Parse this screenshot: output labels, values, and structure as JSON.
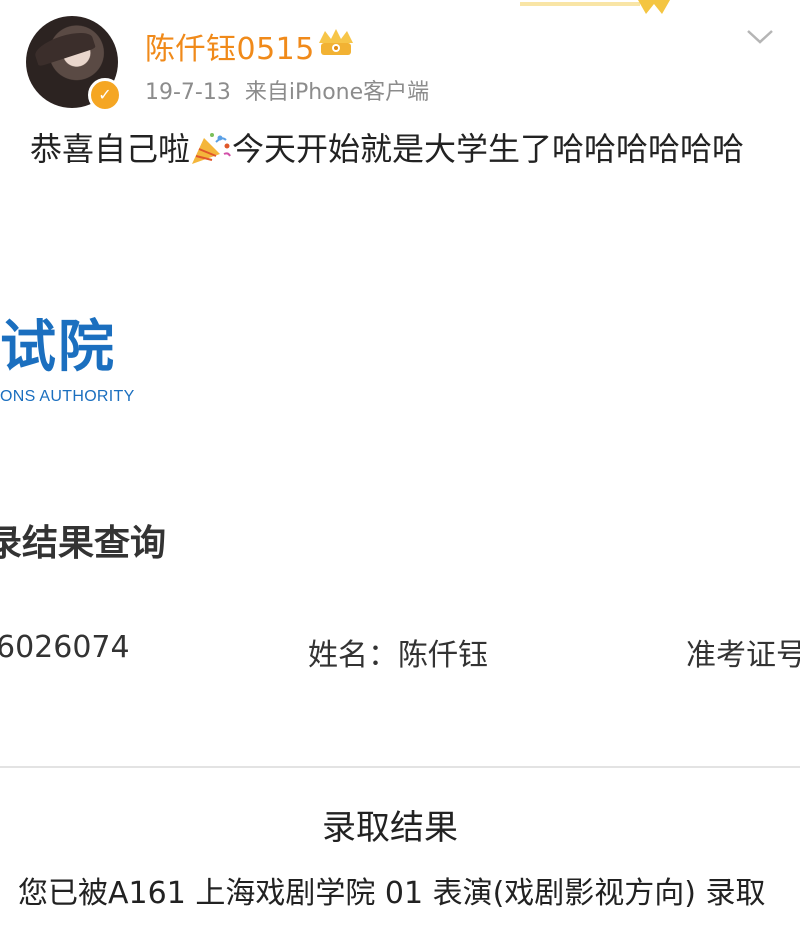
{
  "post": {
    "username": "陈仟钰0515",
    "date": "19-7-13",
    "source": "来自iPhone客户端",
    "text_before_emoji": "恭喜自己啦",
    "text_after_emoji": "今天开始就是大学生了哈哈哈哈哈哈"
  },
  "result_page": {
    "logo_text": "试院",
    "logo_subtitle": "ONS AUTHORITY",
    "title": "录结果查询",
    "id_value": "6026074",
    "name_label_value": "姓名：陈仟钰",
    "ticket_label": "准考证号",
    "admission_title": "录取结果",
    "admission_text": "您已被A161 上海戏剧学院 01 表演(戏剧影视方向) 录取"
  },
  "colors": {
    "username": "#f08a1a",
    "verify_badge": "#f5a623",
    "logo_blue": "#1b6fbf",
    "meta_gray": "#8c8c8c"
  },
  "icons": {
    "avatar": "avatar",
    "verified": "verified-badge-icon",
    "crown": "crown-icon",
    "menu": "chevron-down-icon",
    "party": "party-popper-icon"
  }
}
